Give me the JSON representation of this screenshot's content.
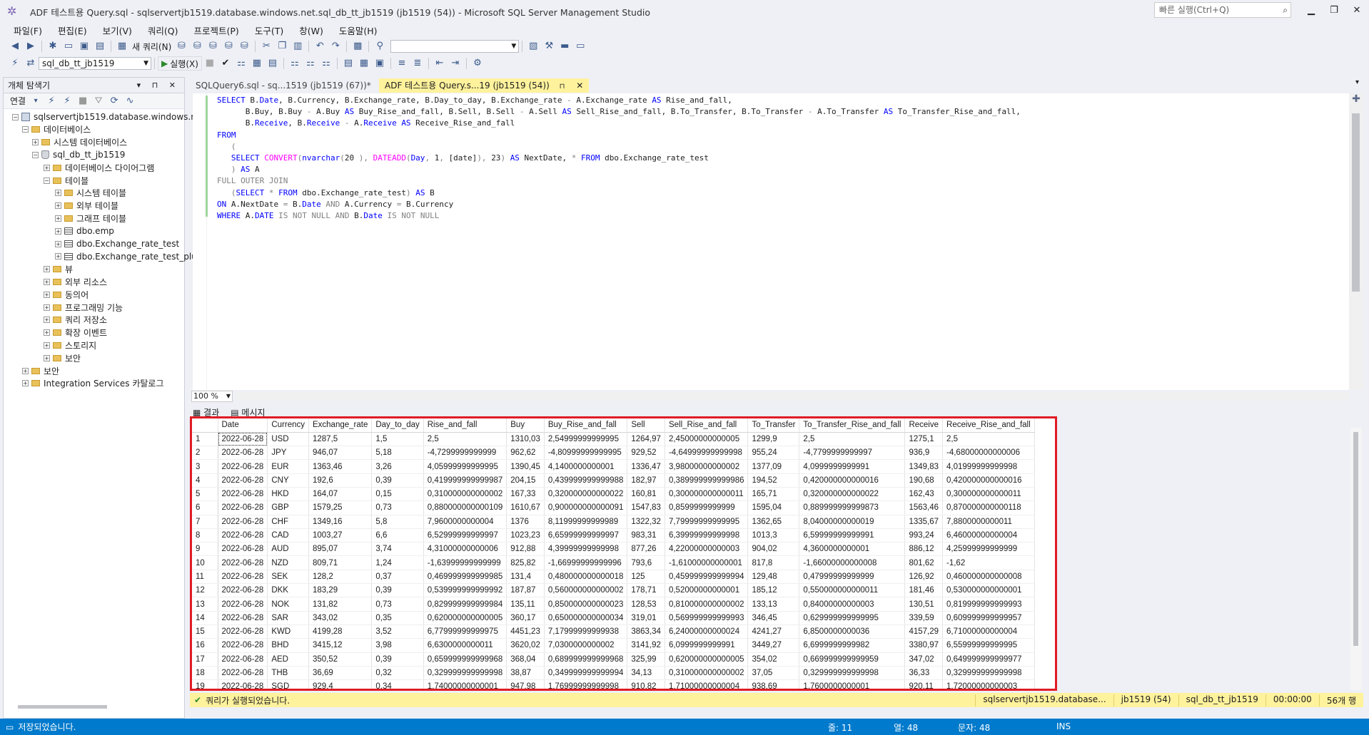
{
  "window": {
    "title": "ADF 테스트용 Query.sql - sqlservertjb1519.database.windows.net.sql_db_tt_jb1519 (jb1519 (54)) - Microsoft SQL Server Management Studio",
    "quick_launch_placeholder": "빠른 실행(Ctrl+Q)"
  },
  "menu": [
    "파일(F)",
    "편집(E)",
    "보기(V)",
    "쿼리(Q)",
    "프로젝트(P)",
    "도구(T)",
    "창(W)",
    "도움말(H)"
  ],
  "toolbar": {
    "new_query_label": "새 쿼리(N)",
    "database_select": "sql_db_tt_jb1519",
    "execute_label": "실행(X)"
  },
  "object_explorer": {
    "title": "개체 탐색기",
    "connect_label": "연결",
    "nodes": [
      {
        "label": "sqlservertjb1519.database.windows.net",
        "level": 0,
        "icon": "server-icon",
        "expander": "−"
      },
      {
        "label": "데이터베이스",
        "level": 1,
        "icon": "folder-icon",
        "expander": "−"
      },
      {
        "label": "시스템 데이터베이스",
        "level": 2,
        "icon": "folder-icon",
        "expander": "+"
      },
      {
        "label": "sql_db_tt_jb1519",
        "level": 2,
        "icon": "database-icon",
        "expander": "−"
      },
      {
        "label": "데이터베이스 다이어그램",
        "level": 3,
        "icon": "folder-icon",
        "expander": "+"
      },
      {
        "label": "테이블",
        "level": 3,
        "icon": "folder-icon",
        "expander": "−"
      },
      {
        "label": "시스템 테이블",
        "level": 4,
        "icon": "folder-icon",
        "expander": "+"
      },
      {
        "label": "외부 테이블",
        "level": 4,
        "icon": "folder-icon",
        "expander": "+"
      },
      {
        "label": "그래프 테이블",
        "level": 4,
        "icon": "folder-icon",
        "expander": "+"
      },
      {
        "label": "dbo.emp",
        "level": 4,
        "icon": "table-icon",
        "expander": "+"
      },
      {
        "label": "dbo.Exchange_rate_test",
        "level": 4,
        "icon": "table-icon",
        "expander": "+"
      },
      {
        "label": "dbo.Exchange_rate_test_plus",
        "level": 4,
        "icon": "table-icon",
        "expander": "+"
      },
      {
        "label": "뷰",
        "level": 3,
        "icon": "folder-icon",
        "expander": "+"
      },
      {
        "label": "외부 리소스",
        "level": 3,
        "icon": "folder-icon",
        "expander": "+"
      },
      {
        "label": "동의어",
        "level": 3,
        "icon": "folder-icon",
        "expander": "+"
      },
      {
        "label": "프로그래밍 기능",
        "level": 3,
        "icon": "folder-icon",
        "expander": "+"
      },
      {
        "label": "쿼리 저장소",
        "level": 3,
        "icon": "folder-icon",
        "expander": "+"
      },
      {
        "label": "확장 이벤트",
        "level": 3,
        "icon": "folder-icon",
        "expander": "+"
      },
      {
        "label": "스토리지",
        "level": 3,
        "icon": "folder-icon",
        "expander": "+"
      },
      {
        "label": "보안",
        "level": 3,
        "icon": "folder-icon",
        "expander": "+"
      },
      {
        "label": "보안",
        "level": 1,
        "icon": "folder-icon",
        "expander": "+"
      },
      {
        "label": "Integration Services 카탈로그",
        "level": 1,
        "icon": "folder-icon",
        "expander": "+"
      }
    ]
  },
  "tabs": [
    {
      "label": "SQLQuery6.sql - sq...1519 (jb1519 (67))*"
    },
    {
      "label": "ADF 테스트용 Query.s...19 (jb1519 (54))"
    }
  ],
  "editor": {
    "zoom": "100 %",
    "lines": [
      [
        [
          "kw",
          "SELECT "
        ],
        [
          "t",
          "B."
        ],
        [
          "kw",
          "Date"
        ],
        [
          "t",
          ", B.Currency, B.Exchange_rate, B.Day_to_day, B.Exchange_rate "
        ],
        [
          "gr",
          "-"
        ],
        [
          "t",
          " A.Exchange_rate "
        ],
        [
          "kw",
          "AS"
        ],
        [
          "t",
          " Rise_and_fall,"
        ]
      ],
      [
        [
          "t",
          "      B.Buy, B.Buy "
        ],
        [
          "gr",
          "-"
        ],
        [
          "t",
          " A.Buy "
        ],
        [
          "kw",
          "AS"
        ],
        [
          "t",
          " Buy_Rise_and_fall, B.Sell, B.Sell "
        ],
        [
          "gr",
          "-"
        ],
        [
          "t",
          " A.Sell "
        ],
        [
          "kw",
          "AS"
        ],
        [
          "t",
          " Sell_Rise_and_fall, B.To_Transfer, B.To_Transfer "
        ],
        [
          "gr",
          "-"
        ],
        [
          "t",
          " A.To_Transfer "
        ],
        [
          "kw",
          "AS"
        ],
        [
          "t",
          " To_Transfer_Rise_and_fall,"
        ]
      ],
      [
        [
          "t",
          "      B."
        ],
        [
          "kw",
          "Receive"
        ],
        [
          "t",
          ", B."
        ],
        [
          "kw",
          "Receive"
        ],
        [
          "t",
          " "
        ],
        [
          "gr",
          "-"
        ],
        [
          "t",
          " A."
        ],
        [
          "kw",
          "Receive"
        ],
        [
          "t",
          " "
        ],
        [
          "kw",
          "AS"
        ],
        [
          "t",
          " Receive_Rise_and_fall"
        ]
      ],
      [
        [
          "kw",
          "FROM"
        ]
      ],
      [
        [
          "gr",
          "   ("
        ]
      ],
      [
        [
          "t",
          "   "
        ],
        [
          "kw",
          "SELECT "
        ],
        [
          "fn",
          "CONVERT"
        ],
        [
          "gr",
          "("
        ],
        [
          "kw",
          "nvarchar"
        ],
        [
          "gr",
          "("
        ],
        [
          "t",
          "20"
        ],
        [
          "gr",
          " ), "
        ],
        [
          "fn",
          "DATEADD"
        ],
        [
          "gr",
          "("
        ],
        [
          "kw",
          "Day"
        ],
        [
          "gr",
          ", "
        ],
        [
          "t",
          "1"
        ],
        [
          "gr",
          ", "
        ],
        [
          "t",
          "[date]"
        ],
        [
          "gr",
          "), "
        ],
        [
          "t",
          "23"
        ],
        [
          "gr",
          ") "
        ],
        [
          "kw",
          "AS"
        ],
        [
          "t",
          " NextDate, "
        ],
        [
          "gr",
          "*"
        ],
        [
          "t",
          " "
        ],
        [
          "kw",
          "FROM"
        ],
        [
          "t",
          " dbo.Exchange_rate_test"
        ]
      ],
      [
        [
          "gr",
          "   ) "
        ],
        [
          "kw",
          "AS"
        ],
        [
          "t",
          " A"
        ]
      ],
      [
        [
          "gr",
          "FULL OUTER JOIN"
        ]
      ],
      [
        [
          "gr",
          "   ("
        ],
        [
          "kw",
          "SELECT"
        ],
        [
          "gr",
          " * "
        ],
        [
          "kw",
          "FROM"
        ],
        [
          "t",
          " dbo.Exchange_rate_test"
        ],
        [
          "gr",
          ") "
        ],
        [
          "kw",
          "AS"
        ],
        [
          "t",
          " B"
        ]
      ],
      [
        [
          "kw",
          "ON"
        ],
        [
          "t",
          " A.NextDate "
        ],
        [
          "gr",
          "="
        ],
        [
          "t",
          " B."
        ],
        [
          "kw",
          "Date"
        ],
        [
          "t",
          " "
        ],
        [
          "gr",
          "AND"
        ],
        [
          "t",
          " A.Currency "
        ],
        [
          "gr",
          "="
        ],
        [
          "t",
          " B.Currency"
        ]
      ],
      [
        [
          "kw",
          "WHERE"
        ],
        [
          "t",
          " A."
        ],
        [
          "kw",
          "DATE"
        ],
        [
          "t",
          " "
        ],
        [
          "gr",
          "IS NOT NULL AND"
        ],
        [
          "t",
          " B."
        ],
        [
          "kw",
          "Date"
        ],
        [
          "t",
          " "
        ],
        [
          "gr",
          "IS NOT NULL"
        ]
      ]
    ]
  },
  "results": {
    "tab_results": "결과",
    "tab_messages": "메시지",
    "columns": [
      "",
      "Date",
      "Currency",
      "Exchange_rate",
      "Day_to_day",
      "Rise_and_fall",
      "Buy",
      "Buy_Rise_and_fall",
      "Sell",
      "Sell_Rise_and_fall",
      "To_Transfer",
      "To_Transfer_Rise_and_fall",
      "Receive",
      "Receive_Rise_and_fall"
    ],
    "rows": [
      [
        "1",
        "2022-06-28",
        "USD",
        "1287,5",
        "1,5",
        "2,5",
        "1310,03",
        "2,54999999999995",
        "1264,97",
        "2,45000000000005",
        "1299,9",
        "2,5",
        "1275,1",
        "2,5"
      ],
      [
        "2",
        "2022-06-28",
        "JPY",
        "946,07",
        "5,18",
        "-4,7299999999999",
        "962,62",
        "-4,80999999999995",
        "929,52",
        "-4,64999999999998",
        "955,24",
        "-4,7799999999997",
        "936,9",
        "-4,68000000000006"
      ],
      [
        "3",
        "2022-06-28",
        "EUR",
        "1363,46",
        "3,26",
        "4,05999999999995",
        "1390,45",
        "4,1400000000001",
        "1336,47",
        "3,98000000000002",
        "1377,09",
        "4,0999999999991",
        "1349,83",
        "4,01999999999998"
      ],
      [
        "4",
        "2022-06-28",
        "CNY",
        "192,6",
        "0,39",
        "0,419999999999987",
        "204,15",
        "0,439999999999988",
        "182,97",
        "0,389999999999986",
        "194,52",
        "0,420000000000016",
        "190,68",
        "0,420000000000016"
      ],
      [
        "5",
        "2022-06-28",
        "HKD",
        "164,07",
        "0,15",
        "0,310000000000002",
        "167,33",
        "0,320000000000022",
        "160,81",
        "0,300000000000011",
        "165,71",
        "0,320000000000022",
        "162,43",
        "0,300000000000011"
      ],
      [
        "6",
        "2022-06-28",
        "GBP",
        "1579,25",
        "0,73",
        "0,880000000000109",
        "1610,67",
        "0,900000000000091",
        "1547,83",
        "0,8599999999999",
        "1595,04",
        "0,889999999999873",
        "1563,46",
        "0,870000000000118"
      ],
      [
        "7",
        "2022-06-28",
        "CHF",
        "1349,16",
        "5,8",
        "7,9600000000004",
        "1376",
        "8,11999999999989",
        "1322,32",
        "7,79999999999995",
        "1362,65",
        "8,04000000000019",
        "1335,67",
        "7,8800000000011"
      ],
      [
        "8",
        "2022-06-28",
        "CAD",
        "1003,27",
        "6,6",
        "6,52999999999997",
        "1023,23",
        "6,65999999999997",
        "983,31",
        "6,39999999999998",
        "1013,3",
        "6,59999999999991",
        "993,24",
        "6,46000000000004"
      ],
      [
        "9",
        "2022-06-28",
        "AUD",
        "895,07",
        "3,74",
        "4,31000000000006",
        "912,88",
        "4,39999999999998",
        "877,26",
        "4,22000000000003",
        "904,02",
        "4,3600000000001",
        "886,12",
        "4,25999999999999"
      ],
      [
        "10",
        "2022-06-28",
        "NZD",
        "809,71",
        "1,24",
        "-1,63999999999999",
        "825,82",
        "-1,66999999999996",
        "793,6",
        "-1,61000000000001",
        "817,8",
        "-1,66000000000008",
        "801,62",
        "-1,62"
      ],
      [
        "11",
        "2022-06-28",
        "SEK",
        "128,2",
        "0,37",
        "0,469999999999985",
        "131,4",
        "0,480000000000018",
        "125",
        "0,459999999999994",
        "129,48",
        "0,47999999999999",
        "126,92",
        "0,460000000000008"
      ],
      [
        "12",
        "2022-06-28",
        "DKK",
        "183,29",
        "0,39",
        "0,539999999999992",
        "187,87",
        "0,560000000000002",
        "178,71",
        "0,52000000000001",
        "185,12",
        "0,550000000000011",
        "181,46",
        "0,530000000000001"
      ],
      [
        "13",
        "2022-06-28",
        "NOK",
        "131,82",
        "0,73",
        "0,829999999999984",
        "135,11",
        "0,850000000000023",
        "128,53",
        "0,810000000000002",
        "133,13",
        "0,84000000000003",
        "130,51",
        "0,819999999999993"
      ],
      [
        "14",
        "2022-06-28",
        "SAR",
        "343,02",
        "0,35",
        "0,620000000000005",
        "360,17",
        "0,650000000000034",
        "319,01",
        "0,569999999999993",
        "346,45",
        "0,629999999999995",
        "339,59",
        "0,609999999999957"
      ],
      [
        "15",
        "2022-06-28",
        "KWD",
        "4199,28",
        "3,52",
        "6,77999999999975",
        "4451,23",
        "7,17999999999938",
        "3863,34",
        "6,24000000000024",
        "4241,27",
        "6,8500000000036",
        "4157,29",
        "6,71000000000004"
      ],
      [
        "16",
        "2022-06-28",
        "BHD",
        "3415,12",
        "3,98",
        "6,6300000000011",
        "3620,02",
        "7,0300000000002",
        "3141,92",
        "6,0999999999991",
        "3449,27",
        "6,6999999999982",
        "3380,97",
        "6,55999999999995"
      ],
      [
        "17",
        "2022-06-28",
        "AED",
        "350,52",
        "0,39",
        "0,659999999999968",
        "368,04",
        "0,689999999999968",
        "325,99",
        "0,620000000000005",
        "354,02",
        "0,669999999999959",
        "347,02",
        "0,649999999999977"
      ],
      [
        "18",
        "2022-06-28",
        "THB",
        "36,69",
        "0,32",
        "0,329999999999998",
        "38,87",
        "0,349999999999994",
        "34,13",
        "0,310000000000002",
        "37,05",
        "0,329999999999998",
        "36,33",
        "0,329999999999998"
      ],
      [
        "19",
        "2022-06-28",
        "SGD",
        "929,4",
        "0,34",
        "1,74000000000001",
        "947,98",
        "1,76999999999998",
        "910,82",
        "1,71000000000004",
        "938,69",
        "1,7600000000001",
        "920,11",
        "1,72000000000003"
      ]
    ]
  },
  "query_status": {
    "message": "쿼리가 실행되었습니다.",
    "server": "sqlservertjb1519.database...",
    "user": "jb1519 (54)",
    "database": "sql_db_tt_jb1519",
    "elapsed": "00:00:00",
    "rows": "56개 행"
  },
  "statusbar": {
    "message": "저장되었습니다.",
    "line": "줄: 11",
    "col": "열: 48",
    "char": "문자: 48",
    "mode": "INS"
  },
  "colors": {
    "accent": "#007acc",
    "tab_highlight": "#fff29d",
    "result_border": "#e01b24"
  }
}
